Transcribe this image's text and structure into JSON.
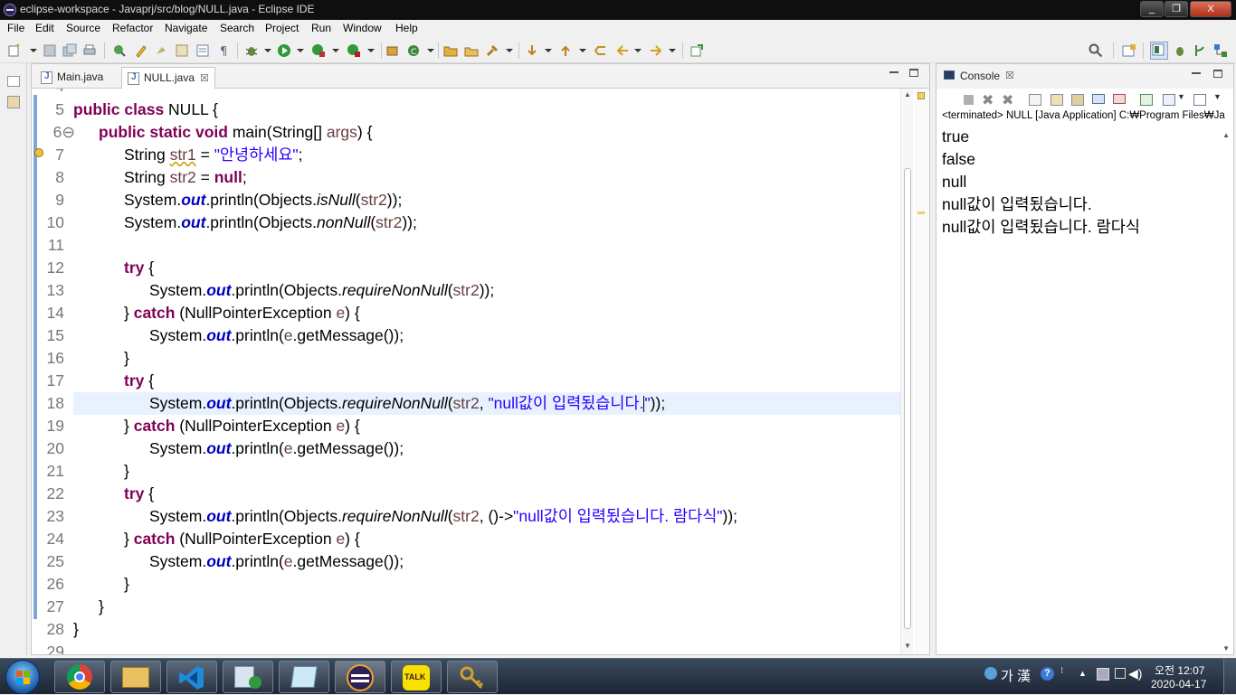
{
  "window": {
    "title": "eclipse-workspace - Javaprj/src/blog/NULL.java - Eclipse IDE",
    "buttons": {
      "minimize": "_",
      "maximize": "❐",
      "close": "X"
    }
  },
  "menu": [
    "File",
    "Edit",
    "Source",
    "Refactor",
    "Navigate",
    "Search",
    "Project",
    "Run",
    "Window",
    "Help"
  ],
  "editor": {
    "tabs": [
      {
        "label": "Main.java",
        "active": false
      },
      {
        "label": "NULL.java",
        "active": true,
        "close": "☒"
      }
    ],
    "line_numbers": [
      "4",
      "5",
      "6⊖",
      "7",
      "8",
      "9",
      "10",
      "11",
      "12",
      "13",
      "14",
      "15",
      "16",
      "17",
      "18",
      "19",
      "20",
      "21",
      "22",
      "23",
      "24",
      "25",
      "26",
      "27",
      "28",
      "29"
    ],
    "code": {
      "l5": {
        "kw1": "public class ",
        "rest": "NULL {"
      },
      "l6": {
        "kw1": "public static void ",
        "rest": "main(String[] ",
        "var": "args",
        "tail": ") {"
      },
      "l7": {
        "a": "String ",
        "var": "str1",
        "b": " = ",
        "str": "\"안녕하세요\"",
        "c": ";"
      },
      "l8": {
        "a": "String ",
        "var": "str2",
        "b": " = ",
        "kw": "null",
        "c": ";"
      },
      "l9": {
        "a": "System.",
        "fld": "out",
        "b": ".println(Objects.",
        "sm": "isNull",
        "c": "(",
        "var": "str2",
        "d": "));"
      },
      "l10": {
        "a": "System.",
        "fld": "out",
        "b": ".println(Objects.",
        "sm": "nonNull",
        "c": "(",
        "var": "str2",
        "d": "));"
      },
      "l12": {
        "kw": "try",
        "rest": " {"
      },
      "l13": {
        "a": "System.",
        "fld": "out",
        "b": ".println(Objects.",
        "sm": "requireNonNull",
        "c": "(",
        "var": "str2",
        "d": "));"
      },
      "l14": {
        "a": "} ",
        "kw": "catch",
        "b": " (NullPointerException ",
        "var": "e",
        "c": ") {"
      },
      "l15": {
        "a": "System.",
        "fld": "out",
        "b": ".println(",
        "var": "e",
        "c": ".getMessage());"
      },
      "l16": {
        "a": "}"
      },
      "l17": {
        "kw": "try",
        "rest": " {"
      },
      "l18": {
        "a": "System.",
        "fld": "out",
        "b": ".println(Objects.",
        "sm": "requireNonNull",
        "c": "(",
        "var": "str2",
        "d": ", ",
        "str": "\"null값이 입력됬습니다.",
        "str2": "\"",
        "e": "));"
      },
      "l19": {
        "a": "} ",
        "kw": "catch",
        "b": " (NullPointerException ",
        "var": "e",
        "c": ") {"
      },
      "l20": {
        "a": "System.",
        "fld": "out",
        "b": ".println(",
        "var": "e",
        "c": ".getMessage());"
      },
      "l21": {
        "a": "}"
      },
      "l22": {
        "kw": "try",
        "rest": " {"
      },
      "l23": {
        "a": "System.",
        "fld": "out",
        "b": ".println(Objects.",
        "sm": "requireNonNull",
        "c": "(",
        "var": "str2",
        "d": ", ()->",
        "str": "\"null값이 입력됬습니다. 람다식\"",
        "e": "));"
      },
      "l24": {
        "a": "} ",
        "kw": "catch",
        "b": " (NullPointerException ",
        "var": "e",
        "c": ") {"
      },
      "l25": {
        "a": "System.",
        "fld": "out",
        "b": ".println(",
        "var": "e",
        "c": ".getMessage());"
      },
      "l26": {
        "a": "}"
      },
      "l27": {
        "a": "}"
      },
      "l28": {
        "a": "}"
      }
    }
  },
  "console": {
    "tab_label": "Console",
    "tab_close": "☒",
    "status": "<terminated> NULL [Java Application] C:₩Program Files₩Ja",
    "output": [
      "true",
      "false",
      "null",
      "null값이 입력됬습니다.",
      "null값이 입력됬습니다. 람다식"
    ]
  },
  "taskbar": {
    "apps": [
      "start-orb",
      "chrome",
      "file-explorer",
      "visual-studio-code",
      "app-runner",
      "notepad",
      "eclipse",
      "kakaotalk",
      "keys-tool"
    ],
    "ime": "가 漢",
    "clock_time": "오전 12:07",
    "clock_date": "2020-04-17",
    "kakao_label": "TALK"
  },
  "colors": {
    "keyword": "#7f0055",
    "string": "#2a00ff",
    "field": "#0000c0",
    "current_line": "#e8f2fe",
    "title_bar": "#0f0f0f"
  }
}
